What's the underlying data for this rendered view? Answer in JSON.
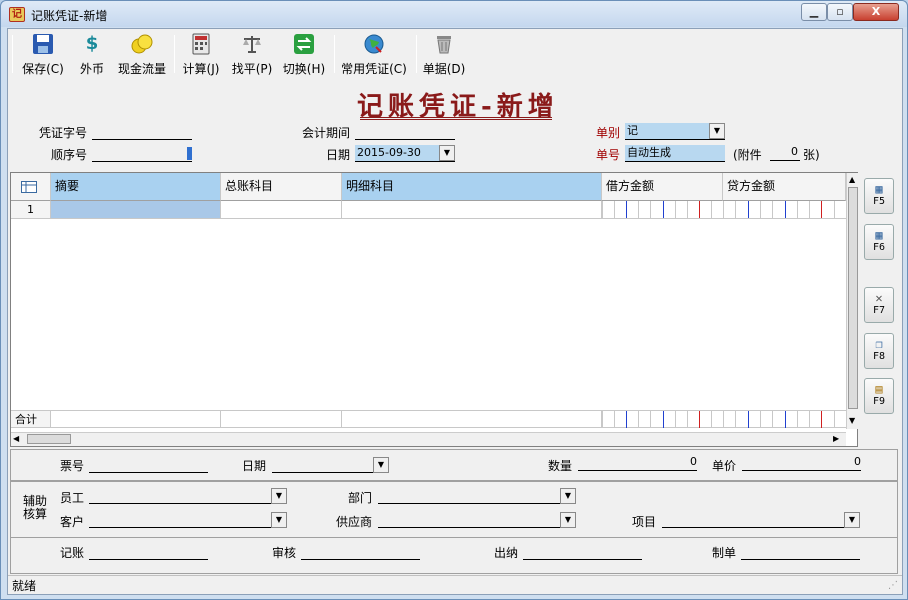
{
  "window": {
    "title": "记账凭证-新增",
    "min_glyph": "▁",
    "max_glyph": "▫",
    "close_glyph": "X",
    "icon_glyph": "记"
  },
  "toolbar": {
    "save": "保存(C)",
    "fx": "外币",
    "cashflow": "现金流量",
    "calc": "计算(J)",
    "balance": "找平(P)",
    "switch": "切换(H)",
    "common": "常用凭证(C)",
    "docs": "单据(D)"
  },
  "header": {
    "title": "记账凭证-新增",
    "voucher_word_label": "凭证字号",
    "voucher_word_value": "",
    "seq_label": "顺序号",
    "seq_value": "",
    "period_label": "会计期间",
    "period_value": "",
    "date_label": "日期",
    "date_value": "2015-09-30",
    "type_label": "单别",
    "type_value": "记",
    "no_label": "单号",
    "no_value": "自动生成",
    "attach_prefix": "(附件",
    "attach_value": "0",
    "attach_suffix": "张)"
  },
  "grid": {
    "columns": [
      "摘要",
      "总账科目",
      "明细科目",
      "借方金额",
      "贷方金额"
    ],
    "rows": [
      {
        "index": "1",
        "summary": "",
        "general": "",
        "detail": "",
        "debit": "",
        "credit": ""
      }
    ],
    "total_label": "合计"
  },
  "side_buttons": [
    "F5",
    "F6",
    "F7",
    "F8",
    "F9"
  ],
  "extra": {
    "ticket_label": "票号",
    "date_label": "日期",
    "qty_label": "数量",
    "qty_value": "0",
    "price_label": "单价",
    "price_value": "0"
  },
  "aux": {
    "section_label_1": "辅助",
    "section_label_2": "核算",
    "employee_label": "员工",
    "dept_label": "部门",
    "customer_label": "客户",
    "supplier_label": "供应商",
    "project_label": "项目"
  },
  "sign": {
    "bookkeeper": "记账",
    "audit": "审核",
    "cashier": "出纳",
    "maker": "制单"
  },
  "status": {
    "text": "就绪"
  }
}
